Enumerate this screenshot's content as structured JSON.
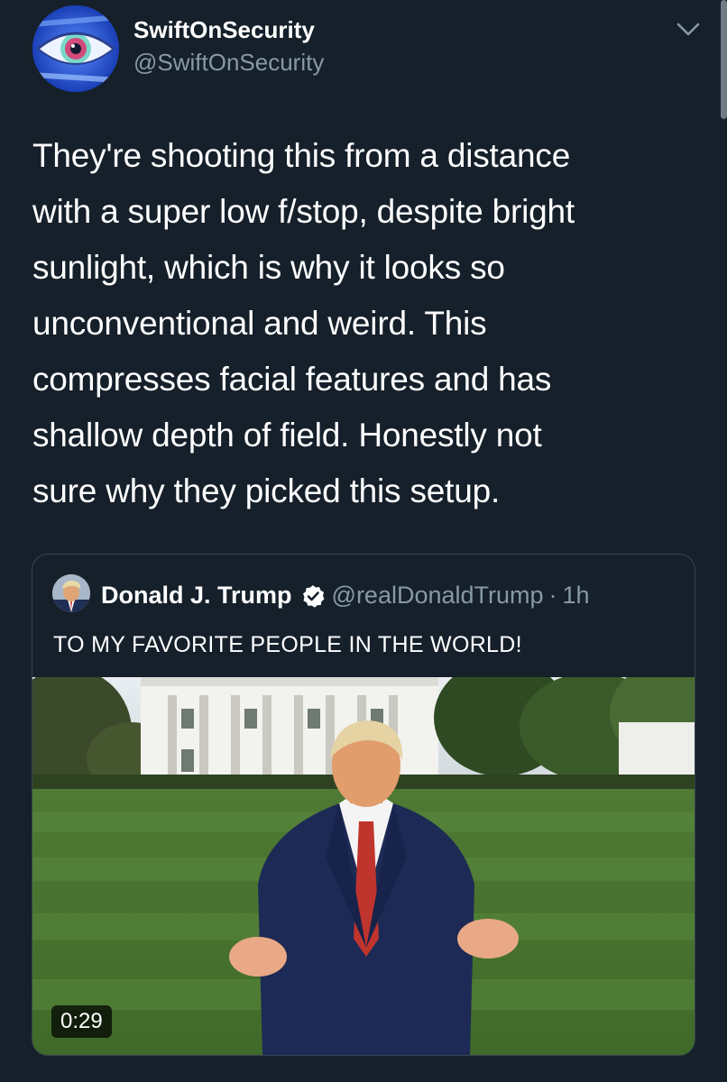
{
  "tweet": {
    "author_name": "SwiftOnSecurity",
    "author_handle": "@SwiftOnSecurity",
    "text": "They're shooting this from a distance\nwith a super low f/stop, despite bright\nsunlight, which is why it looks so\nunconventional and weird. This\ncompresses facial features and has\nshallow depth of field. Honestly not\nsure why they picked this setup.",
    "menu_icon": "chevron-down-icon"
  },
  "quote": {
    "author_name": "Donald J. Trump",
    "author_handle": "@realDonaldTrump",
    "separator": "·",
    "time": "1h",
    "verified_icon": "verified-badge-icon",
    "text": "TO MY FAVORITE PEOPLE IN THE WORLD!",
    "video": {
      "duration": "0:29"
    }
  },
  "colors": {
    "background": "#15202b",
    "text_primary": "#ffffff",
    "text_secondary": "#8899a6",
    "border": "#38444d"
  }
}
